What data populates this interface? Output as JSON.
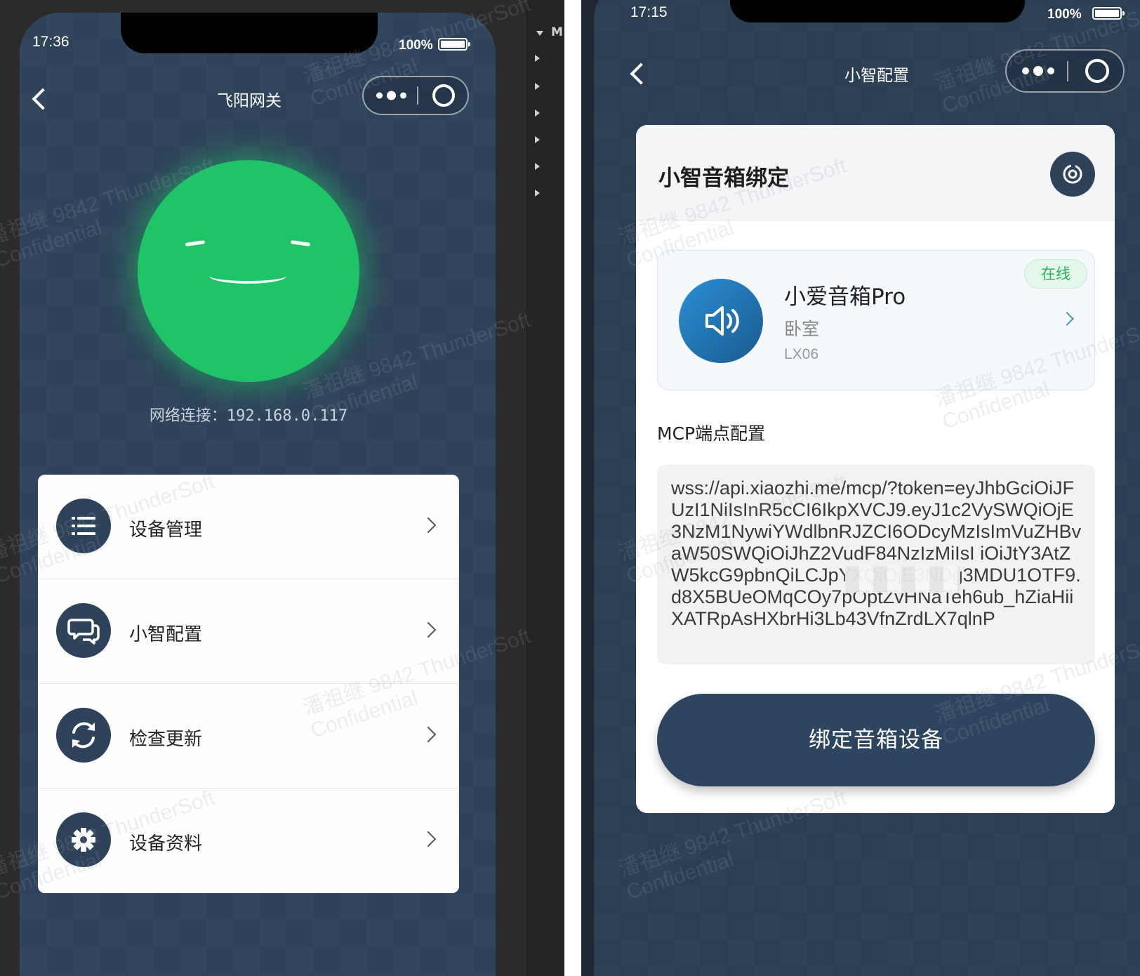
{
  "left_phone": {
    "status": {
      "time": "17:36",
      "battery": "100%"
    },
    "nav": {
      "title": "飞阳网关"
    },
    "network_text": "网络连接：192.168.0.117",
    "menu": [
      {
        "label": "设备管理",
        "icon": "list-icon"
      },
      {
        "label": "小智配置",
        "icon": "chat-icon"
      },
      {
        "label": "检查更新",
        "icon": "refresh-icon"
      },
      {
        "label": "设备资料",
        "icon": "gear-icon"
      }
    ],
    "face_color": "#1ec467"
  },
  "devtools": {
    "tab_label": "M"
  },
  "right_phone": {
    "status": {
      "time": "17:15",
      "battery": "100%"
    },
    "nav": {
      "title": "小智配置"
    },
    "card_title": "小智音箱绑定",
    "device": {
      "name": "小爱音箱Pro",
      "room": "卧室",
      "model": "LX06",
      "status_badge": "在线"
    },
    "mcp_label": "MCP端点配置",
    "mcp_value": "wss://api.xiaozhi.me/mcp/?token=eyJhbGciOiJFUzI1NiIsInR5cCI6IkpXVCJ9.eyJ1c2VySWQiOjE3NzM1NywiYWdlbnRJZCI6ODcyMzIsImVuZHBvaW50SWQiOiJhZ2VudF84NzIzMiIsI          iOiJtY3AtZW5kcG9pbnQiLCJpYXQiOjE3NDg3MDU1OTF9.d8X5BUeOMqCOy7pOptZvHNaTeh6ub_hZiaHiiXATRpAsHXbrHi3Lb43VfnZrdLX7qlnP",
    "bind_button": "绑定音箱设备"
  },
  "watermark": {
    "line1": "潘祖继 9842 ThunderSoft",
    "line2": "Confidential"
  },
  "colors": {
    "primary": "#2e435a",
    "online_green": "#2bb35b",
    "device_blue": "#2b8fd6"
  }
}
